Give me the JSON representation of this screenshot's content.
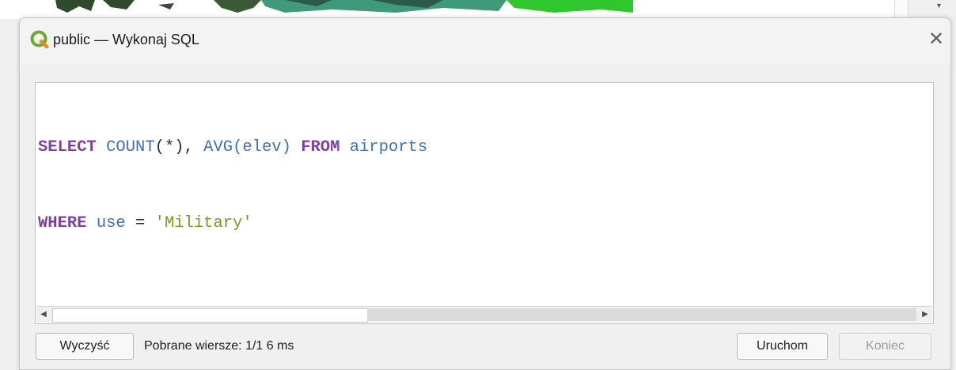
{
  "window": {
    "title": "public — Wykonaj SQL",
    "close_glyph": "✕",
    "icon": "qgis-logo-icon"
  },
  "sql_editor": {
    "line1": {
      "kw1": "SELECT",
      "fn1": "COUNT",
      "p1": "(*), ",
      "fn2": "AVG",
      "p2": "(elev) ",
      "kw2": "FROM",
      "ident": " airports"
    },
    "line2": {
      "kw1": "WHERE",
      "ident": " use ",
      "op": "=",
      "str": " 'Military'"
    }
  },
  "footer": {
    "clear_label": "Wyczyść",
    "status": "Pobrane wiersze: 1/1  6 ms",
    "run_label": "Uruchom",
    "end_label": "Koniec"
  },
  "colors": {
    "keyword": "#7f3f9f",
    "function": "#3f70b7",
    "string": "#7a9a1e"
  }
}
